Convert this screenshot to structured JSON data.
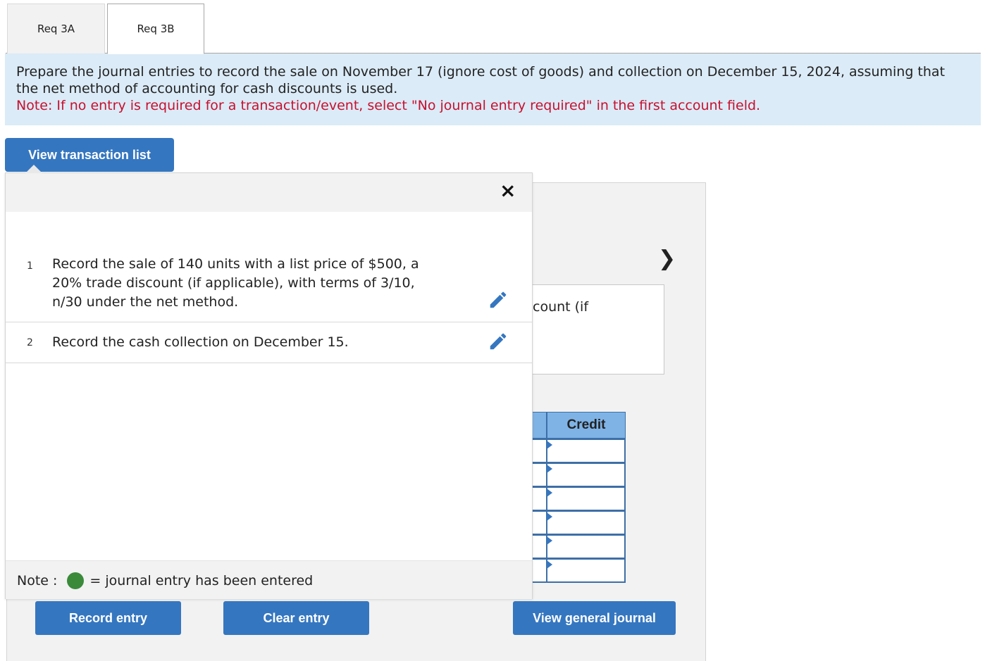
{
  "tabs": [
    {
      "label": "Req 3A"
    },
    {
      "label": "Req 3B"
    }
  ],
  "instructions": {
    "text": "Prepare the journal entries to record the sale on November 17 (ignore cost of goods) and collection on December 15, 2024, assuming that the net method of accounting for cash discounts is used.",
    "note": "Note: If no entry is required for a transaction/event, select \"No journal entry required\" in the first account field."
  },
  "view_transaction_list": {
    "label": "View transaction list"
  },
  "popup": {
    "close_icon": "×",
    "transactions": [
      {
        "num": "1",
        "text": "Record the sale of 140 units with a list price of $500, a 20% trade discount (if applicable), with terms of 3/10, n/30 under the net method."
      },
      {
        "num": "2",
        "text": "Record the cash collection on December 15."
      }
    ],
    "footer_note_label": "Note :",
    "footer_note_text": "= journal entry has been entered"
  },
  "journal": {
    "chevron": "❯",
    "desc_partial": "count (if",
    "credit_header": "Credit",
    "row_count": 6
  },
  "buttons": {
    "record": "Record entry",
    "clear": "Clear entry",
    "view_general_journal": "View general journal"
  },
  "colors": {
    "accent": "#3576c0",
    "instr_bg": "#dbebf7",
    "note_red": "#c8102e",
    "header_blue": "#7fb3e6",
    "entered_dot": "#3a8a3a"
  }
}
